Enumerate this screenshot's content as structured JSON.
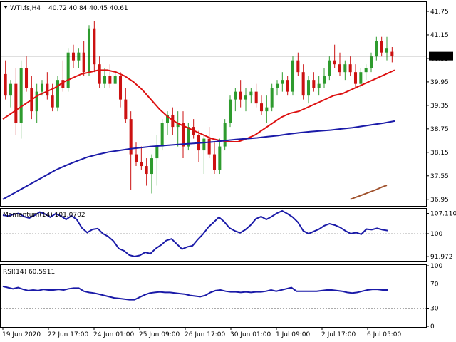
{
  "main_panel": {
    "symbol_label": "WTI.fs,H4",
    "ohlc_label": "40.72 40.84 40.45 40.61",
    "last_price_tag": "40.61",
    "price_ticks": [
      "41.75",
      "41.15",
      "40.55",
      "39.95",
      "39.35",
      "38.75",
      "38.15",
      "37.55",
      "36.95"
    ]
  },
  "momentum_panel": {
    "label": "Momentum(14) 101.0702",
    "ticks": [
      "107.1101",
      "100",
      "91.972"
    ]
  },
  "rsi_panel": {
    "label": "RSI(14) 60.5911",
    "ticks": [
      "100",
      "70",
      "30",
      "0"
    ]
  },
  "time_axis": {
    "labels": [
      "19 Jun 2020",
      "22 Jun 17:00",
      "24 Jun 01:00",
      "25 Jun 09:00",
      "26 Jun 17:00",
      "30 Jun 01:00",
      "1 Jul 09:00",
      "2 Jul 17:00",
      "6 Jul 05:00"
    ]
  },
  "colors": {
    "bull": "#2e9b2e",
    "bear": "#cc1111",
    "ma_fast": "#dd1010",
    "ma_mid": "#1a1aa8",
    "ma_slow": "#a0522d",
    "osc": "#1a1aa8",
    "grid_axis": "#000000",
    "level": "#aaaaaa"
  },
  "chart_data": [
    {
      "type": "candlestick",
      "title": "WTI.fs,H4",
      "ylim": [
        36.8,
        41.95
      ],
      "price_ticks": [
        41.75,
        41.15,
        40.55,
        39.95,
        39.35,
        38.75,
        38.15,
        37.55,
        36.95
      ],
      "last_price": 40.61,
      "candles": [
        [
          40.15,
          40.5,
          39.5,
          39.6
        ],
        [
          39.6,
          40.0,
          39.3,
          39.9
        ],
        [
          39.9,
          40.3,
          38.6,
          38.9
        ],
        [
          38.9,
          40.5,
          38.5,
          40.3
        ],
        [
          40.3,
          40.6,
          39.7,
          39.8
        ],
        [
          39.8,
          40.1,
          39.0,
          39.2
        ],
        [
          39.2,
          39.9,
          38.9,
          39.7
        ],
        [
          39.7,
          40.0,
          39.6,
          39.9
        ],
        [
          39.9,
          40.2,
          39.5,
          39.6
        ],
        [
          39.6,
          39.9,
          39.2,
          39.3
        ],
        [
          39.3,
          40.1,
          39.2,
          40.0
        ],
        [
          40.0,
          40.5,
          39.7,
          39.8
        ],
        [
          39.8,
          40.8,
          39.7,
          40.7
        ],
        [
          40.7,
          40.9,
          40.3,
          40.5
        ],
        [
          40.5,
          40.8,
          40.3,
          40.7
        ],
        [
          40.7,
          41.0,
          40.1,
          40.2
        ],
        [
          40.2,
          41.4,
          40.1,
          41.3
        ],
        [
          41.3,
          41.5,
          40.2,
          40.4
        ],
        [
          40.4,
          40.6,
          39.8,
          39.9
        ],
        [
          39.9,
          40.3,
          39.8,
          40.1
        ],
        [
          40.1,
          40.4,
          39.8,
          39.9
        ],
        [
          39.9,
          40.2,
          39.9,
          40.1
        ],
        [
          40.1,
          40.2,
          39.3,
          39.5
        ],
        [
          39.5,
          39.8,
          38.9,
          39.0
        ],
        [
          39.0,
          39.2,
          37.2,
          38.1
        ],
        [
          38.1,
          38.4,
          37.8,
          37.9
        ],
        [
          37.9,
          38.3,
          37.7,
          37.8
        ],
        [
          37.8,
          38.0,
          37.3,
          37.6
        ],
        [
          37.6,
          38.1,
          37.1,
          38.0
        ],
        [
          38.0,
          38.6,
          37.3,
          38.3
        ],
        [
          38.3,
          39.0,
          38.2,
          38.9
        ],
        [
          38.9,
          39.2,
          38.6,
          39.1
        ],
        [
          39.1,
          39.3,
          38.6,
          38.8
        ],
        [
          38.8,
          39.2,
          38.3,
          38.9
        ],
        [
          38.9,
          39.2,
          38.0,
          38.3
        ],
        [
          38.3,
          38.9,
          38.2,
          38.8
        ],
        [
          38.8,
          39.0,
          38.5,
          38.6
        ],
        [
          38.6,
          38.7,
          37.9,
          38.2
        ],
        [
          38.2,
          38.6,
          37.6,
          38.5
        ],
        [
          38.5,
          38.8,
          38.0,
          38.1
        ],
        [
          38.1,
          38.4,
          37.6,
          37.7
        ],
        [
          37.7,
          38.5,
          37.6,
          38.3
        ],
        [
          38.3,
          39.0,
          38.2,
          38.9
        ],
        [
          38.9,
          39.6,
          38.8,
          39.5
        ],
        [
          39.5,
          39.8,
          39.2,
          39.7
        ],
        [
          39.7,
          40.0,
          39.3,
          39.5
        ],
        [
          39.5,
          39.8,
          39.2,
          39.6
        ],
        [
          39.6,
          39.8,
          39.4,
          39.7
        ],
        [
          39.7,
          39.9,
          39.3,
          39.4
        ],
        [
          39.4,
          39.6,
          39.1,
          39.2
        ],
        [
          39.2,
          39.6,
          38.9,
          39.3
        ],
        [
          39.3,
          39.9,
          39.2,
          39.8
        ],
        [
          39.8,
          40.0,
          39.6,
          39.9
        ],
        [
          39.9,
          40.2,
          39.7,
          40.0
        ],
        [
          40.0,
          40.1,
          39.6,
          39.7
        ],
        [
          39.7,
          40.6,
          39.6,
          40.5
        ],
        [
          40.5,
          40.7,
          40.1,
          40.2
        ],
        [
          40.2,
          40.4,
          39.5,
          39.6
        ],
        [
          39.6,
          40.1,
          39.4,
          40.0
        ],
        [
          40.0,
          40.2,
          39.7,
          39.8
        ],
        [
          39.8,
          40.1,
          39.6,
          39.9
        ],
        [
          39.9,
          40.3,
          39.8,
          40.1
        ],
        [
          40.1,
          40.6,
          40.0,
          40.5
        ],
        [
          40.5,
          40.9,
          40.3,
          40.4
        ],
        [
          40.4,
          40.7,
          40.1,
          40.2
        ],
        [
          40.2,
          40.5,
          40.0,
          40.4
        ],
        [
          40.4,
          40.6,
          40.1,
          40.2
        ],
        [
          40.2,
          40.4,
          39.8,
          39.9
        ],
        [
          39.9,
          40.3,
          39.8,
          40.2
        ],
        [
          40.2,
          40.4,
          40.0,
          40.3
        ],
        [
          40.3,
          40.7,
          40.2,
          40.6
        ],
        [
          40.6,
          41.1,
          40.5,
          41.0
        ],
        [
          41.0,
          41.1,
          40.6,
          40.7
        ],
        [
          40.7,
          41.1,
          40.5,
          40.8
        ],
        [
          40.72,
          40.84,
          40.45,
          40.61
        ]
      ],
      "ma_fast": [
        39.0,
        39.15,
        39.3,
        39.45,
        39.6,
        39.7,
        39.8,
        39.95,
        40.05,
        40.15,
        40.2,
        40.25,
        40.25,
        40.2,
        40.1,
        39.95,
        39.75,
        39.5,
        39.25,
        39.05,
        38.9,
        38.8,
        38.7,
        38.6,
        38.5,
        38.45,
        38.42,
        38.42,
        38.5,
        38.6,
        38.75,
        38.9,
        39.05,
        39.15,
        39.2,
        39.3,
        39.4,
        39.5,
        39.6,
        39.65,
        39.75,
        39.85,
        39.95,
        40.05,
        40.15,
        40.25
      ],
      "ma_mid": [
        36.95,
        37.1,
        37.25,
        37.4,
        37.55,
        37.7,
        37.82,
        37.93,
        38.03,
        38.1,
        38.16,
        38.2,
        38.24,
        38.27,
        38.3,
        38.32,
        38.34,
        38.36,
        38.38,
        38.4,
        38.42,
        38.45,
        38.48,
        38.5,
        38.52,
        38.55,
        38.58,
        38.62,
        38.65,
        38.68,
        38.7,
        38.72,
        38.75,
        38.78,
        38.82,
        38.86,
        38.9,
        38.95
      ],
      "ma_slow": [
        36.95,
        37.0,
        37.05,
        37.1,
        37.15,
        37.2,
        37.26,
        37.31
      ],
      "ma_slow_start_index": 66
    },
    {
      "type": "line",
      "title": "Momentum(14) 101.0702",
      "ylim": [
        90.5,
        108.5
      ],
      "ticks": [
        107.1101,
        100,
        91.972
      ],
      "values": [
        106.5,
        106.2,
        106.8,
        107.1,
        106.0,
        105.5,
        106.4,
        107.6,
        106.9,
        105.8,
        107.0,
        106.2,
        105.0,
        106.3,
        105.0,
        102.0,
        100.4,
        101.5,
        101.8,
        100.0,
        99.0,
        97.4,
        94.8,
        94.0,
        92.5,
        92.0,
        92.4,
        93.5,
        93.0,
        94.8,
        96.0,
        97.6,
        98.2,
        96.4,
        94.6,
        95.4,
        95.8,
        98.0,
        99.9,
        102.3,
        104.0,
        105.8,
        104.2,
        102.0,
        101.0,
        100.3,
        101.4,
        103.0,
        105.2,
        106.0,
        105.0,
        106.0,
        107.2,
        108.0,
        107.0,
        105.8,
        104.0,
        101.0,
        100.0,
        100.8,
        101.6,
        102.8,
        103.5,
        103.0,
        102.2,
        101.0,
        100.0,
        100.4,
        99.8,
        101.6,
        101.4,
        101.9,
        101.4,
        101.1
      ]
    },
    {
      "type": "line",
      "title": "RSI(14) 60.5911",
      "ylim": [
        0,
        100
      ],
      "ticks": [
        100,
        70,
        30,
        0
      ],
      "levels": [
        70,
        30
      ],
      "values": [
        66,
        64,
        62,
        64,
        61,
        59,
        60,
        59,
        61,
        60,
        60,
        61,
        60,
        62,
        63,
        63,
        58,
        56,
        55,
        53,
        51,
        49,
        47,
        46,
        45,
        44,
        44,
        48,
        52,
        55,
        56,
        57,
        56,
        56,
        55,
        54,
        53,
        51,
        50,
        49,
        51,
        56,
        59,
        60,
        58,
        57,
        57,
        56,
        57,
        56,
        57,
        57,
        58,
        60,
        58,
        60,
        62,
        64,
        58,
        58,
        58,
        58,
        58,
        59,
        60,
        60,
        59,
        58,
        56,
        55,
        56,
        58,
        60,
        61,
        61,
        60,
        60
      ]
    }
  ]
}
